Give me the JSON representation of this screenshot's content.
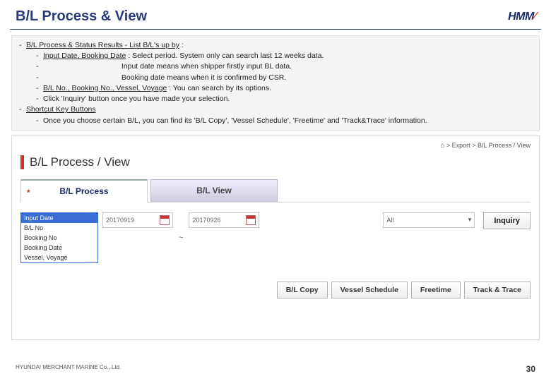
{
  "header": {
    "title": "B/L Process & View",
    "logo": "HMM"
  },
  "info": {
    "h1": "B/L Process & Status Results  - List B/L's up by",
    "h1_suffix": " :",
    "i1_label": "Input Date, Booking Date",
    "i1_text": " : Select period. System only can search last 12 weeks data.",
    "i2": "                                      Input date means when shipper firstly input BL data.",
    "i3": "                                      Booking date means when it is confirmed by CSR.",
    "i4_label": "B/L No., Booking No., Vessel, Voyage",
    "i4_text": " : You can search by its options.",
    "i5": "Click 'Inquiry' button once you have made your selection.",
    "h2": "Shortcut Key Buttons",
    "s1": "Once you choose certain B/L, you can find its 'B/L Copy', 'Vessel Schedule', 'Freetime' and 'Track&Trace' information."
  },
  "app": {
    "breadcrumb_sep": " > ",
    "breadcrumb_1": "Export",
    "breadcrumb_2": "B/L Process / View",
    "title": "B/L Process / View",
    "tabs": {
      "active": "B/L Process",
      "inactive": "B/L View",
      "asterisk": "*"
    },
    "dropdown": {
      "selected": "Input Date",
      "opts": [
        "B/L No",
        "Booking No",
        "Booking Date",
        "Vessel, Voyage"
      ]
    },
    "date_from": "20170919",
    "date_to": "20170926",
    "select_all": "All",
    "inquiry": "Inquiry",
    "shortcuts": [
      "B/L Copy",
      "Vessel Schedule",
      "Freetime",
      "Track & Trace"
    ]
  },
  "footer": {
    "company": "HYUNDAI MERCHANT MARINE Co., Ltd.",
    "page": "30"
  }
}
